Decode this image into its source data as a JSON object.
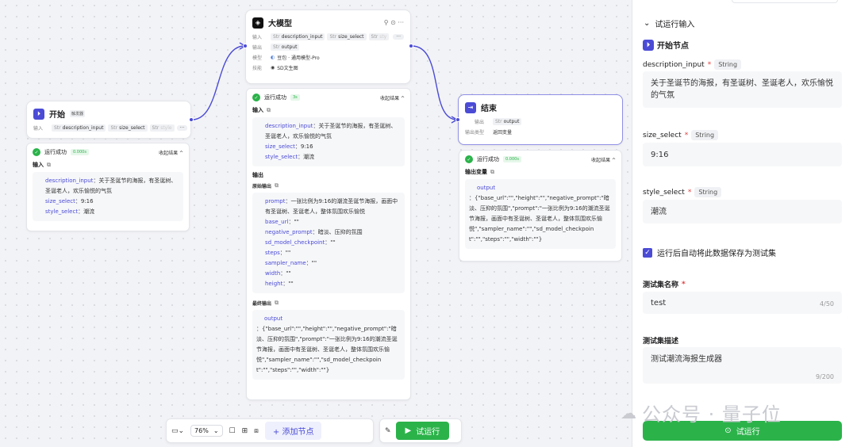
{
  "start": {
    "title": "开始",
    "badge": "触发器",
    "input_label": "输入",
    "chips": [
      {
        "t": "Str",
        "n": "description_input"
      },
      {
        "t": "Str",
        "n": "size_select"
      },
      {
        "t": "Str",
        "n": "style"
      }
    ],
    "more": "···"
  },
  "start_result": {
    "status": "运行成功",
    "time": "0.000s",
    "collapse": "收起结果 ^",
    "input_title": "输入",
    "lines": [
      {
        "k": "description_input",
        "v": "：关于圣诞节的海报，有圣诞树、圣诞老人，欢乐愉悦的气氛"
      },
      {
        "k": "size_select",
        "v": "：9:16"
      },
      {
        "k": "style_select",
        "v": "：潮流"
      }
    ]
  },
  "llm": {
    "title": "大模型",
    "input_label": "输入",
    "output_label": "输出",
    "model_label": "模型",
    "skill_label": "技能",
    "chips": [
      {
        "t": "Str",
        "n": "description_input"
      },
      {
        "t": "Str",
        "n": "size_select"
      },
      {
        "t": "Str",
        "n": "sty"
      }
    ],
    "output_chip": {
      "t": "Str",
      "n": "output"
    },
    "model": "豆包 · 通用模型-Pro",
    "skill": "SD文生图",
    "more": "···"
  },
  "llm_result": {
    "status": "运行成功",
    "time": "3s",
    "collapse": "收起结果 ^",
    "input_title": "输入",
    "input_lines": [
      {
        "k": "description_input",
        "v": "：关于圣诞节的海报，有圣诞树、圣诞老人，欢乐愉悦的气氛"
      },
      {
        "k": "size_select",
        "v": "：9:16"
      },
      {
        "k": "style_select",
        "v": "：潮流"
      }
    ],
    "output_title": "输出",
    "raw_title": "原始输出",
    "raw_lines": [
      {
        "k": "prompt",
        "v": "：一张比例为9:16的潮流圣诞节海报，画面中有圣诞树、圣诞老人，整体氛围欢乐愉悦"
      },
      {
        "k": "base_url",
        "v": "：\"\""
      },
      {
        "k": "negative_prompt",
        "v": "：暗淡、压抑的氛围"
      },
      {
        "k": "sd_model_checkpoint",
        "v": "：\"\""
      },
      {
        "k": "steps",
        "v": "：\"\""
      },
      {
        "k": "sampler_name",
        "v": "：\"\""
      },
      {
        "k": "width",
        "v": "：\"\""
      },
      {
        "k": "height",
        "v": "：\"\""
      }
    ],
    "final_title": "最终输出",
    "final_key": "output",
    "final_value": "：{\"base_url\":\"\",\"height\":\"\",\"negative_prompt\":\"暗淡、压抑的氛围\",\"prompt\":\"一张比例为9:16的潮流圣诞节海报，画面中有圣诞树、圣诞老人，整体氛围欢乐愉悦\",\"sampler_name\":\"\",\"sd_model_checkpoint\":\"\",\"steps\":\"\",\"width\":\"\"}"
  },
  "end": {
    "title": "结束",
    "output_label": "输出",
    "output_chip": {
      "t": "Str",
      "n": "output"
    },
    "type_label": "输出类型",
    "type_value": "返回变量"
  },
  "end_result": {
    "status": "运行成功",
    "time": "0.000s",
    "collapse": "收起结果 ^",
    "var_title": "输出变量",
    "key": "output",
    "value": "：{\"base_url\":\"\",\"height\":\"\",\"negative_prompt\":\"暗淡、压抑的氛围\",\"prompt\":\"一张比例为9:16的潮流圣诞节海报，画面中有圣诞树、圣诞老人，整体氛围欢乐愉悦\",\"sampler_name\":\"\",\"sd_model_checkpoint\":\"\",\"steps\":\"\",\"width\":\"\"}"
  },
  "toolbar": {
    "zoom": "76%",
    "add_node": "添加节点",
    "run": "试运行"
  },
  "panel": {
    "header": "试运行输入",
    "node": "开始节点",
    "fields": [
      {
        "label": "description_input",
        "type": "String",
        "value": "关于圣诞节的海报，有圣诞树、圣诞老人，欢乐愉悦的气氛"
      },
      {
        "label": "size_select",
        "type": "String",
        "value": "9:16"
      },
      {
        "label": "style_select",
        "type": "String",
        "value": "潮流"
      }
    ],
    "save_check": "运行后自动将此数据保存为测试集",
    "set_name_label": "测试集名称",
    "set_name_value": "test",
    "set_name_count": "4/50",
    "set_desc_label": "测试集描述",
    "set_desc_value": "测试潮流海报生成器",
    "set_desc_count": "9/200",
    "run": "试运行",
    "watermark": "公众号 · 量子位"
  },
  "colors": {
    "accent": "#4b4bd6",
    "success": "#2bb34a"
  }
}
